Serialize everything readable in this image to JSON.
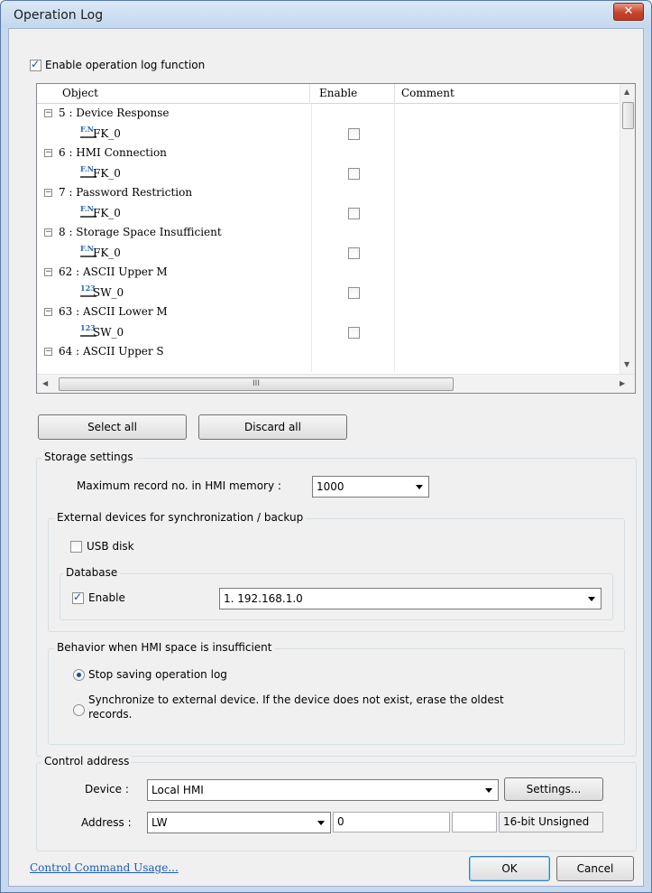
{
  "window": {
    "title": "Operation Log",
    "close_glyph": "✕"
  },
  "enable_log": {
    "label": "Enable operation log function",
    "checked": true
  },
  "grid": {
    "columns": [
      "Object",
      "Enable",
      "Comment"
    ],
    "rows": [
      {
        "kind": "group",
        "text": "5 : Device Response"
      },
      {
        "kind": "item",
        "text": "FK_0",
        "icon": "function-key-icon"
      },
      {
        "kind": "group",
        "text": "6 : HMI Connection"
      },
      {
        "kind": "item",
        "text": "FK_0",
        "icon": "function-key-icon"
      },
      {
        "kind": "group",
        "text": "7 : Password Restriction"
      },
      {
        "kind": "item",
        "text": "FK_0",
        "icon": "function-key-icon"
      },
      {
        "kind": "group",
        "text": "8 : Storage Space Insufficient"
      },
      {
        "kind": "item",
        "text": "FK_0",
        "icon": "function-key-icon"
      },
      {
        "kind": "group",
        "text": "62 : ASCII Upper M"
      },
      {
        "kind": "item",
        "text": "SW_0",
        "icon": "switch-icon"
      },
      {
        "kind": "group",
        "text": "63 : ASCII Lower M"
      },
      {
        "kind": "item",
        "text": "SW_0",
        "icon": "switch-icon"
      },
      {
        "kind": "group",
        "text": "64 : ASCII Upper S"
      }
    ],
    "hscroll_grip": "III"
  },
  "buttons": {
    "select_all": "Select all",
    "discard_all": "Discard all"
  },
  "storage": {
    "title": "Storage settings",
    "max_record_label": "Maximum record no. in HMI memory :",
    "max_record_value": "1000",
    "external": {
      "title": "External devices for synchronization / backup",
      "usb_label": "USB disk",
      "usb_checked": false,
      "database": {
        "title": "Database",
        "enable_label": "Enable",
        "enable_checked": true,
        "server_value": "1. 192.168.1.0"
      }
    },
    "behavior": {
      "title": "Behavior when HMI space is insufficient",
      "option1": "Stop saving operation log",
      "option2_line1": "Synchronize to external device. If the device does not exist, erase the oldest",
      "option2_line2": "records.",
      "selected": "option1"
    }
  },
  "control": {
    "title": "Control address",
    "device_label": "Device :",
    "device_value": "Local HMI",
    "settings_label": "Settings...",
    "address_label": "Address :",
    "address_type": "LW",
    "address_value": "0",
    "data_format": "16-bit Unsigned"
  },
  "footer": {
    "link": "Control Command Usage...",
    "ok": "OK",
    "cancel": "Cancel"
  }
}
